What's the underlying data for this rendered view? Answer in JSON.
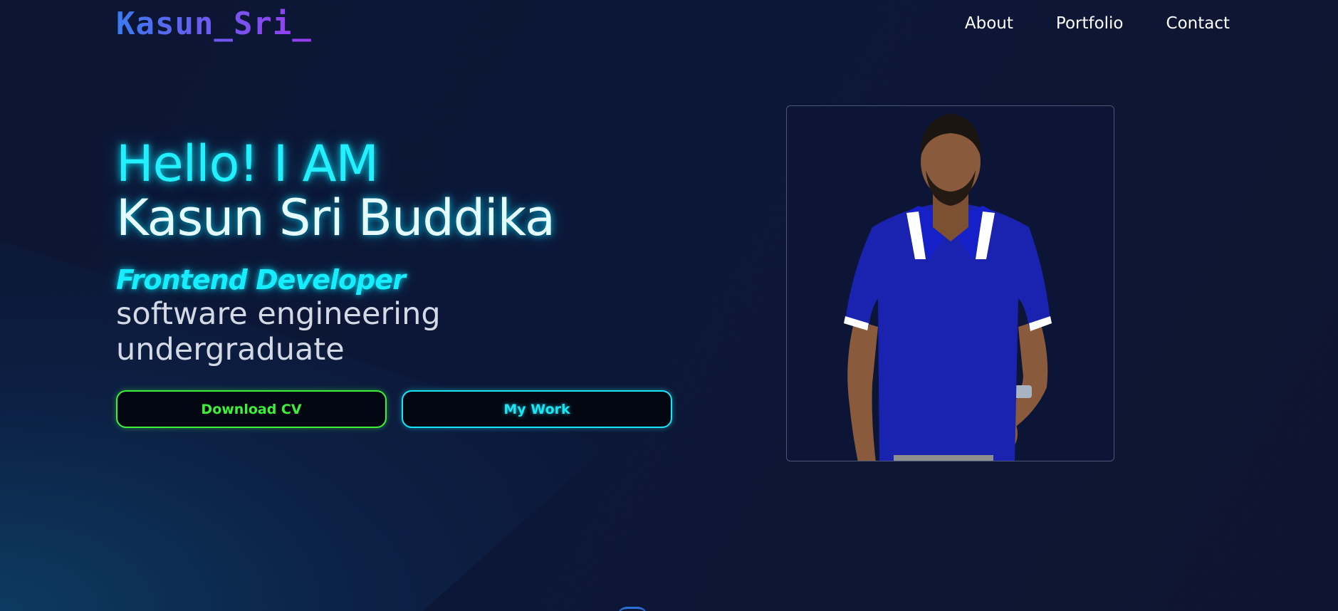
{
  "navbar": {
    "logo": "Kasun_Sri_",
    "links": [
      "About",
      "Portfolio",
      "Contact"
    ]
  },
  "hero": {
    "greeting": "Hello! I AM",
    "name": "Kasun Sri Buddika",
    "role": "Frontend Developer",
    "subtitle": "software engineering undergraduate",
    "buttons": {
      "download_cv": "Download CV",
      "my_work": "My Work"
    }
  },
  "colors": {
    "background": "#0c1633",
    "accent_cyan": "#22f0ff",
    "accent_green": "#3ef03a",
    "logo_gradient": [
      "#3a7bf0",
      "#9b3cf0"
    ]
  },
  "icons": {
    "scroll_hint": "scroll-down-icon"
  }
}
